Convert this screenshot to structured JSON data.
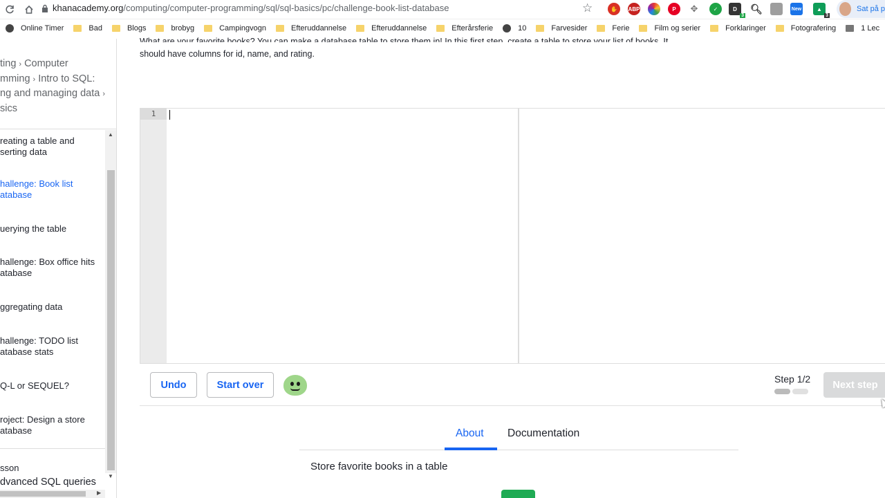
{
  "browser": {
    "url_host": "khanacademy.org",
    "url_path": "/computing/computer-programming/sql/sql-basics/pc/challenge-book-list-database",
    "profile_label": "Sat på p",
    "extension_badges": [
      "ABP",
      "3",
      "New",
      "3"
    ]
  },
  "bookmarks": [
    {
      "label": "Online Timer",
      "icon": "clock-icon"
    },
    {
      "label": "Bad",
      "icon": "folder-icon"
    },
    {
      "label": "Blogs",
      "icon": "folder-icon"
    },
    {
      "label": "brobyg",
      "icon": "folder-icon"
    },
    {
      "label": "Campingvogn",
      "icon": "folder-icon"
    },
    {
      "label": "Efteruddannelse",
      "icon": "folder-icon"
    },
    {
      "label": "Efteruddannelse",
      "icon": "folder-icon"
    },
    {
      "label": "Efterårsferie",
      "icon": "folder-icon"
    },
    {
      "label": "10",
      "icon": "globe-icon"
    },
    {
      "label": "Farvesider",
      "icon": "folder-icon"
    },
    {
      "label": "Ferie",
      "icon": "folder-icon"
    },
    {
      "label": "Film og serier",
      "icon": "folder-icon"
    },
    {
      "label": "Forklaringer",
      "icon": "folder-icon"
    },
    {
      "label": "Fotografering",
      "icon": "folder-icon"
    },
    {
      "label": "1 Lec",
      "icon": "chart-icon"
    }
  ],
  "sidebar": {
    "breadcrumb": [
      "ting",
      "Computer",
      "mming",
      "Intro to SQL:",
      "ng and managing data",
      "sics"
    ],
    "lessons": [
      {
        "label_1": "reating a table and",
        "label_2": "serting data",
        "active": false
      },
      {
        "label_1": "hallenge: Book list",
        "label_2": "atabase",
        "active": true
      },
      {
        "label_1": "uerying the table",
        "label_2": "",
        "active": false
      },
      {
        "label_1": "hallenge: Box office hits",
        "label_2": "atabase",
        "active": false
      },
      {
        "label_1": "ggregating data",
        "label_2": "",
        "active": false
      },
      {
        "label_1": "hallenge: TODO list",
        "label_2": "atabase stats",
        "active": false
      },
      {
        "label_1": "Q-L or SEQUEL?",
        "label_2": "",
        "active": false
      },
      {
        "label_1": "roject: Design a store",
        "label_2": "atabase",
        "active": false
      }
    ],
    "footer_label_1": "sson",
    "footer_label_2": "dvanced SQL queries"
  },
  "main": {
    "intro_line_1": "What are your favorite books? You can make a database table to store them in! In this first step, create a table to store your list of books. It",
    "intro_line_2": "should have columns for id, name, and rating.",
    "editor_line_number": "1",
    "undo_label": "Undo",
    "start_over_label": "Start over",
    "step_label": "Step 1/2",
    "steps_completed": 1,
    "steps_total": 2,
    "next_step_label": "Next step",
    "tabs": [
      {
        "label": "About",
        "active": true
      },
      {
        "label": "Documentation",
        "active": false
      }
    ],
    "about_text": "Store favorite books in a table"
  },
  "colors": {
    "accent": "#1865f2",
    "next_disabled": "#d9dadb",
    "green": "#1fab54"
  }
}
